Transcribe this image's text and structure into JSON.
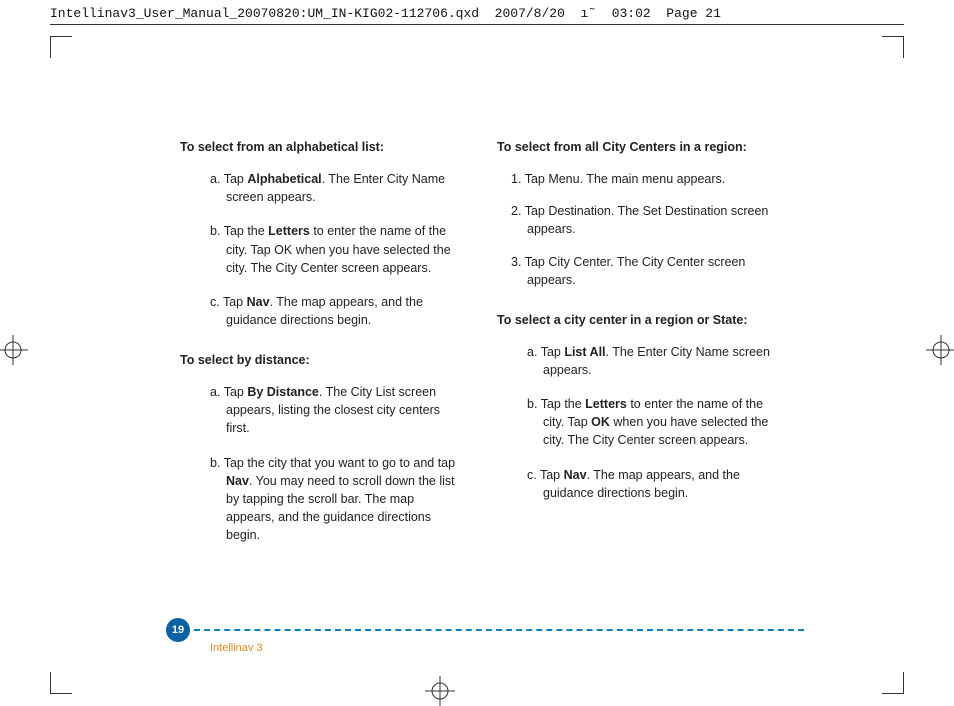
{
  "header": {
    "text": "Intellinav3_User_Manual_20070820:UM_IN-KIG02-112706.qxd  2007/8/20  ı˜  03:02  Page 21"
  },
  "left": {
    "h1": "To select from an alphabetical list:",
    "a": {
      "m": "a.",
      "pre": "Tap ",
      "bold": "Alphabetical",
      "post": ". The Enter City Name screen appears."
    },
    "b": {
      "m": "b.",
      "pre": "Tap the ",
      "bold": "Letters",
      "post": " to enter the name of the city. Tap OK when you have selected the city. The City Center screen appears."
    },
    "c": {
      "m": "c.",
      "pre": "Tap ",
      "bold": "Nav",
      "post": ". The map appears, and the guidance directions begin."
    },
    "h2": "To select by distance:",
    "d": {
      "m": "a.",
      "pre": "Tap ",
      "bold": "By Distance",
      "post": ". The City List screen appears, listing the closest city centers first."
    },
    "e": {
      "m": "b.",
      "pre": "Tap the city that you want to go to and tap ",
      "bold": "Nav",
      "post": ". You may need to scroll down the list by tapping the scroll bar. The map appears, and the guidance directions begin."
    }
  },
  "right": {
    "h1": "To select from all City Centers in a region:",
    "n1": {
      "m": "1.",
      "text": "Tap Menu. The main menu appears."
    },
    "n2": {
      "m": "2.",
      "text": "Tap Destination. The Set Destination screen appears."
    },
    "n3": {
      "m": "3.",
      "text": "Tap City Center. The City Center screen appears."
    },
    "h2": "To select a city center in a region or State:",
    "a": {
      "m": "a.",
      "pre": "Tap ",
      "bold": "List All",
      "post": ". The Enter City Name screen appears."
    },
    "b": {
      "m": "b.",
      "pre": "Tap the ",
      "bold": "Letters",
      "mid": " to enter the name of the city. Tap ",
      "bold2": "OK",
      "post": " when you have selected the city. The City Center screen appears."
    },
    "c": {
      "m": "c.",
      "pre": "Tap ",
      "bold": "Nav",
      "post": ". The map appears, and the guidance directions begin."
    }
  },
  "footer": {
    "page_number": "19",
    "product": "Intellinav 3"
  }
}
